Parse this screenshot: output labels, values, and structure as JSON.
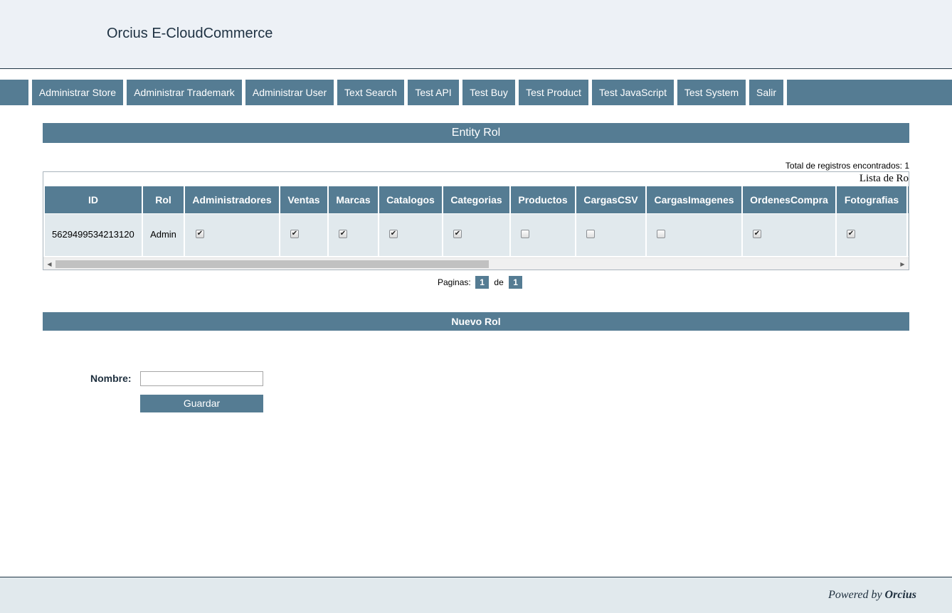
{
  "app": {
    "title": "Orcius E-CloudCommerce"
  },
  "nav": {
    "items": [
      "Administrar Store",
      "Administrar Trademark",
      "Administrar User",
      "Text Search",
      "Test API",
      "Test Buy",
      "Test Product",
      "Test JavaScript",
      "Test System",
      "Salir"
    ]
  },
  "entity": {
    "title": "Entity Rol",
    "total_label": "Total de registros encontrados: 1",
    "caption": "Lista de Ro",
    "columns": [
      "ID",
      "Rol",
      "Administradores",
      "Ventas",
      "Marcas",
      "Catalogos",
      "Categorias",
      "Productos",
      "CargasCSV",
      "CargasImagenes",
      "OrdenesCompra",
      "Fotografias"
    ],
    "rows": [
      {
        "id": "5629499534213120",
        "rol": "Admin",
        "flags": [
          true,
          true,
          true,
          true,
          true,
          false,
          false,
          false,
          true,
          true
        ]
      }
    ]
  },
  "pager": {
    "label": "Paginas:",
    "current": "1",
    "of_label": "de",
    "total": "1"
  },
  "form": {
    "title": "Nuevo Rol",
    "name_label": "Nombre:",
    "name_value": "",
    "save_label": "Guardar"
  },
  "footer": {
    "powered_prefix": "Powered by",
    "powered_brand": "Orcius"
  }
}
